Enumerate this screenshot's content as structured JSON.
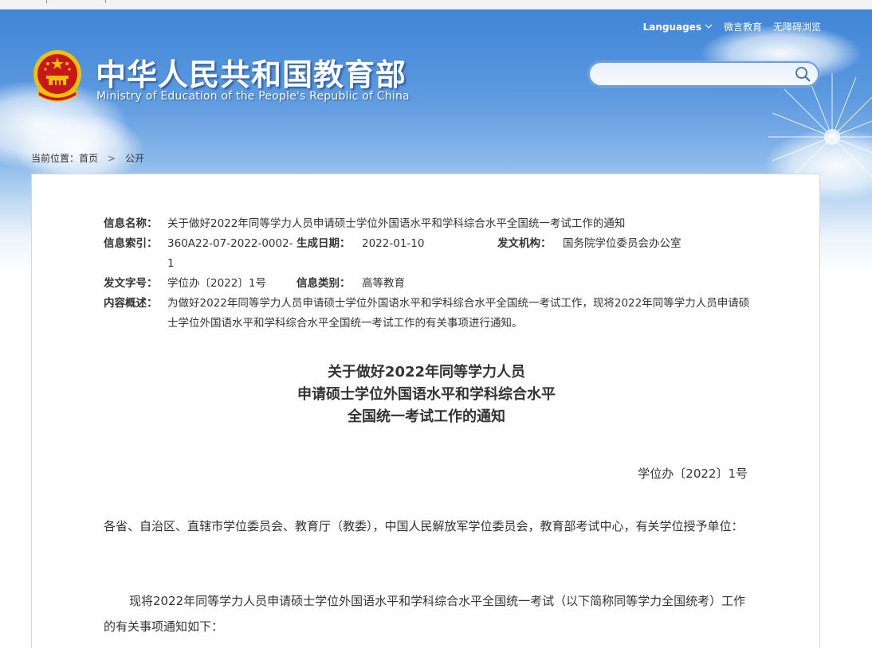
{
  "top_links": {
    "languages": "Languages",
    "weixin": "微言教育",
    "accessible": "无障碍浏览"
  },
  "header": {
    "title_cn": "中华人民共和国教育部",
    "title_en": "Ministry of Education of the People's Republic of China"
  },
  "search": {
    "value": "",
    "placeholder": ""
  },
  "breadcrumb": {
    "prefix": "当前位置：",
    "items": [
      "首页",
      "公开"
    ],
    "separator": ">"
  },
  "meta": {
    "name_label": "信息名称：",
    "name_value": "关于做好2022年同等学力人员申请硕士学位外国语水平和学科综合水平全国统一考试工作的通知",
    "index_label": "信息索引：",
    "index_value": "360A22-07-2022-0002-1",
    "date_label": "生成日期：",
    "date_value": "2022-01-10",
    "org_label": "发文机构：",
    "org_value": "国务院学位委员会办公室",
    "docno_label": "发文字号：",
    "docno_value": "学位办〔2022〕1号",
    "category_label": "信息类别：",
    "category_value": "高等教育",
    "summary_label": "内容概述：",
    "summary_value": "为做好2022年同等学力人员申请硕士学位外国语水平和学科综合水平全国统一考试工作，现将2022年同等学力人员申请硕士学位外国语水平和学科综合水平全国统一考试工作的有关事项进行通知。"
  },
  "document": {
    "title_line1": "关于做好2022年同等学力人员",
    "title_line2": "申请硕士学位外国语水平和学科综合水平",
    "title_line3": "全国统一考试工作的通知",
    "doc_number": "学位办〔2022〕1号",
    "paragraph1": "各省、自治区、直辖市学位委员会、教育厅（教委），中国人民解放军学位委员会，教育部考试中心，有关学位授予单位：",
    "paragraph2": "现将2022年同等学力人员申请硕士学位外国语水平和学科综合水平全国统一考试（以下简称同等学力全国统考）工作的有关事项通知如下："
  },
  "colors": {
    "sky_top": "#3f86d6",
    "emblem_red": "#c8161d",
    "emblem_gold": "#f2c200",
    "text": "#333333"
  },
  "icons": {
    "emblem": "national-emblem-icon",
    "search": "search-icon",
    "dropdown": "chevron-down-icon"
  }
}
